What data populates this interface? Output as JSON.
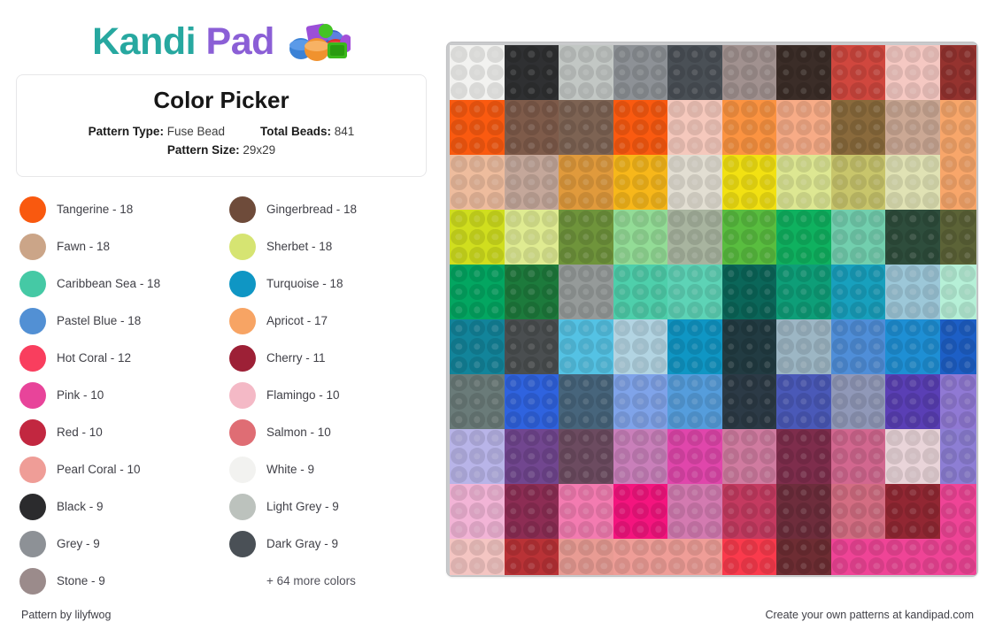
{
  "brand": {
    "name_part1": "Kandi",
    "name_part2": "Pad",
    "beads_icon": "kandi-beads-icon"
  },
  "info": {
    "title": "Color Picker",
    "pattern_type_label": "Pattern Type:",
    "pattern_type_value": "Fuse Bead",
    "total_beads_label": "Total Beads:",
    "total_beads_value": "841",
    "pattern_size_label": "Pattern Size:",
    "pattern_size_value": "29x29"
  },
  "legend": {
    "items": [
      {
        "name": "Tangerine",
        "count": 18,
        "label": "Tangerine - 18",
        "color": "#f9590f"
      },
      {
        "name": "Gingerbread",
        "count": 18,
        "label": "Gingerbread - 18",
        "color": "#6e4b3a"
      },
      {
        "name": "Fawn",
        "count": 18,
        "label": "Fawn - 18",
        "color": "#cba588"
      },
      {
        "name": "Sherbet",
        "count": 18,
        "label": "Sherbet - 18",
        "color": "#d6e472"
      },
      {
        "name": "Caribbean Sea",
        "count": 18,
        "label": "Caribbean Sea - 18",
        "color": "#45c9a5"
      },
      {
        "name": "Turquoise",
        "count": 18,
        "label": "Turquoise - 18",
        "color": "#0f96c4"
      },
      {
        "name": "Pastel Blue",
        "count": 18,
        "label": "Pastel Blue - 18",
        "color": "#5290d4"
      },
      {
        "name": "Apricot",
        "count": 17,
        "label": "Apricot - 17",
        "color": "#f7a464"
      },
      {
        "name": "Hot Coral",
        "count": 12,
        "label": "Hot Coral - 12",
        "color": "#f93e5e"
      },
      {
        "name": "Cherry",
        "count": 11,
        "label": "Cherry - 11",
        "color": "#9d2036"
      },
      {
        "name": "Pink",
        "count": 10,
        "label": "Pink - 10",
        "color": "#e8449a"
      },
      {
        "name": "Flamingo",
        "count": 10,
        "label": "Flamingo - 10",
        "color": "#f4b9c6"
      },
      {
        "name": "Red",
        "count": 10,
        "label": "Red - 10",
        "color": "#c22740"
      },
      {
        "name": "Salmon",
        "count": 10,
        "label": "Salmon - 10",
        "color": "#df6d74"
      },
      {
        "name": "Pearl Coral",
        "count": 10,
        "label": "Pearl Coral - 10",
        "color": "#ef9d97"
      },
      {
        "name": "White",
        "count": 9,
        "label": "White - 9",
        "color": "#f2f2f0"
      },
      {
        "name": "Black",
        "count": 9,
        "label": "Black - 9",
        "color": "#2b2b2d"
      },
      {
        "name": "Light Grey",
        "count": 9,
        "label": "Light Grey - 9",
        "color": "#bcc2bd"
      },
      {
        "name": "Grey",
        "count": 9,
        "label": "Grey - 9",
        "color": "#8d9196"
      },
      {
        "name": "Dark Gray",
        "count": 9,
        "label": "Dark Gray - 9",
        "color": "#4a5056"
      },
      {
        "name": "Stone",
        "count": 9,
        "label": "Stone - 9",
        "color": "#9b8b8b"
      }
    ],
    "more_text": "+ 64 more colors"
  },
  "footer": {
    "credit": "Pattern by lilyfwog",
    "promo": "Create your own patterns at kandipad.com"
  },
  "pattern": {
    "width": 29,
    "height": 29,
    "block": 3,
    "note": "Colors stored per 3x3 block; 10 block-columns x 10 block-rows, last row/col partial (2 beads).",
    "block_rows": [
      [
        "#f2f2f0",
        "#2f3032",
        "#c2c7c4",
        "#8d9196",
        "#4a5056",
        "#a1918f",
        "#3b2d28",
        "#d0473e",
        "#f5c8c2",
        "#95332f"
      ],
      [
        "#fa5a10",
        "#7e5b4a",
        "#7d6353",
        "#fa5a10",
        "#f5c8bc",
        "#fb9341",
        "#f7ab86",
        "#8a6a3c",
        "#cba894",
        "#f8a66a"
      ],
      [
        "#eebc9d",
        "#c4a79a",
        "#e09a3c",
        "#f7b71a",
        "#e2ded2",
        "#f2e112",
        "#dde792",
        "#c8c56b",
        "#e0e2b4",
        "#f8a66a"
      ],
      [
        "#d0de1e",
        "#dfeb91",
        "#6f943b",
        "#93dc96",
        "#a8b49f",
        "#59bd3f",
        "#0fb15f",
        "#72cfae",
        "#2e4d3c",
        "#5c6337"
      ],
      [
        "#03a661",
        "#1d7a3c",
        "#959a99",
        "#4ecfab",
        "#5dd3b6",
        "#0b6659",
        "#0e9e78",
        "#18a0bd",
        "#9cc7d8",
        "#b6f0d7"
      ],
      [
        "#12849a",
        "#4a4e50",
        "#54c2e4",
        "#b2d4e2",
        "#0f96c4",
        "#223b42",
        "#9cb6c4",
        "#4f8ed8",
        "#1e8fd4",
        "#1d5fc6"
      ],
      [
        "#6a7b79",
        "#2f63df",
        "#47657c",
        "#7fa3e9",
        "#559ddc",
        "#2c3a46",
        "#4a59b8",
        "#9098b8",
        "#5a3fb5",
        "#9079d4"
      ],
      [
        "#b8b4e8",
        "#71468f",
        "#6c4b60",
        "#c97fba",
        "#e046ab",
        "#d07ba0",
        "#7e2d4c",
        "#d2678f",
        "#e9d4d9",
        "#8d7ed4"
      ],
      [
        "#f2b4d6",
        "#8d2d54",
        "#f37bb0",
        "#f4157e",
        "#d37ab0",
        "#c43a60",
        "#6e2d3c",
        "#d36d82",
        "#922733",
        "#ef4496"
      ],
      [
        "#f4c5c2",
        "#b93236",
        "#e89b93",
        "#ef9d97",
        "#ef9d97",
        "#fa3a4c",
        "#6e2d33",
        "#ef4496",
        "#ef4496",
        "#ef4496"
      ]
    ]
  }
}
